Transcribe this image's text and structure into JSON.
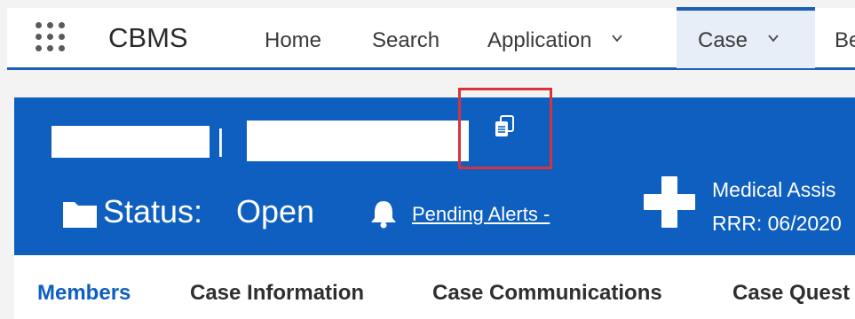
{
  "app": {
    "name": "CBMS"
  },
  "nav": {
    "items": [
      {
        "label": "Home"
      },
      {
        "label": "Search"
      },
      {
        "label": "Application"
      },
      {
        "label": "Case"
      },
      {
        "label": "Be"
      }
    ]
  },
  "header": {
    "status_label": "Status:",
    "status_value": "Open",
    "pending_alerts": "Pending Alerts -",
    "medical_line1": "Medical Assis",
    "medical_line2": "RRR: 06/2020",
    "separator": "|"
  },
  "subtabs": [
    {
      "label": "Members"
    },
    {
      "label": "Case Information"
    },
    {
      "label": "Case Communications"
    },
    {
      "label": "Case Quest"
    }
  ],
  "colors": {
    "brand_blue": "#0e5fbf",
    "highlight_red": "#d8323a"
  },
  "icons": [
    "app-launcher-icon",
    "chevron-down-icon",
    "copy-icon",
    "folder-icon",
    "bell-icon",
    "medical-plus-icon"
  ]
}
